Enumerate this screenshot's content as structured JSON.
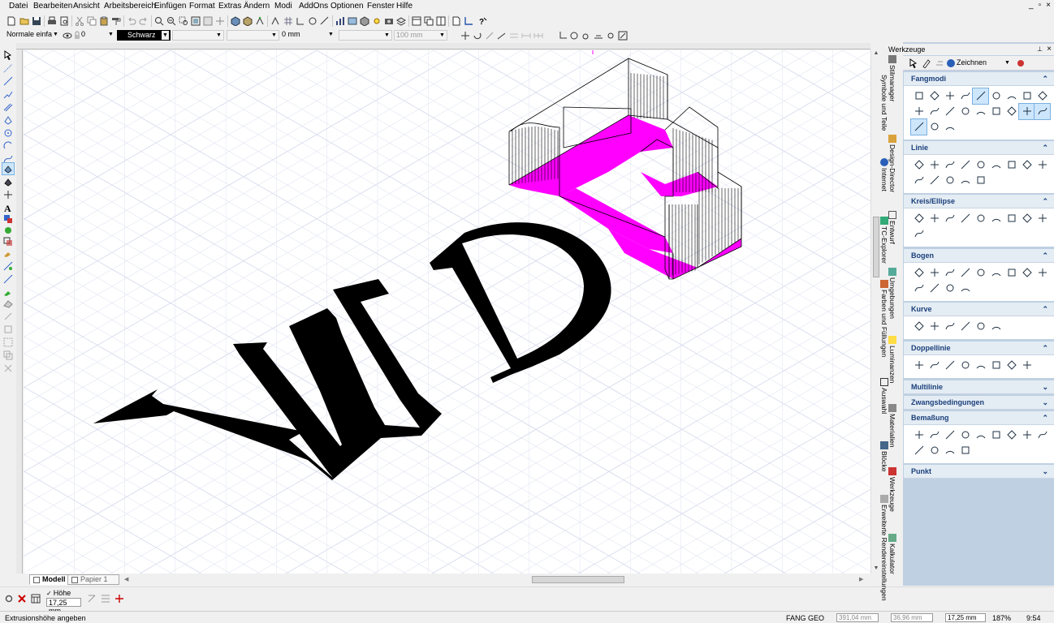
{
  "menu": [
    {
      "label": "Datei"
    },
    {
      "label": "Bearbeiten"
    },
    {
      "label": "Ansicht"
    },
    {
      "label": "Arbeitsbereich"
    },
    {
      "label": "Einfügen"
    },
    {
      "label": "Format"
    },
    {
      "label": "Extras"
    },
    {
      "label": "Ändern"
    },
    {
      "label": "Modi"
    },
    {
      "label": "AddOns"
    },
    {
      "label": "Optionen"
    },
    {
      "label": "Fenster"
    },
    {
      "label": "Hilfe"
    }
  ],
  "window_controls": {
    "minimize": "_",
    "restore": "▫",
    "close": "×"
  },
  "format_bar": {
    "style": "Normale einfa",
    "layer_value": "0",
    "color": "Schwarz",
    "line_width": "0 mm",
    "spacing": "100 mm"
  },
  "tabs": [
    {
      "label": "Modell",
      "active": true
    },
    {
      "label": "Papier 1",
      "active": false
    }
  ],
  "input": {
    "height_label": "Höhe",
    "height_value": "17,25 mm"
  },
  "status": {
    "prompt": "Extrusionshöhe angeben",
    "fang": "FANG",
    "geo": "GEO",
    "coord_x": "391,04 mm",
    "coord_y": "36,96 mm",
    "coord_z": "17,25 mm",
    "zoom": "187%",
    "time": "9:54"
  },
  "side_tabs": [
    "Stilmanager",
    "Symbole und Teile",
    "Design-Director",
    "Internet",
    "Entwurf",
    "TC-Explorer",
    "Umgebungen",
    "Farben und Füllungen",
    "Luminanzen",
    "Auswahl",
    "Materialien",
    "Blöcke",
    "Werkzeuge",
    "Erweiterte Rendereinstellungen",
    "Kalkulator"
  ],
  "panel": {
    "title": "Werkzeuge",
    "mode": "Zeichnen",
    "sections": [
      {
        "label": "Fangmodi",
        "expanded": true
      },
      {
        "label": "Linie",
        "expanded": true
      },
      {
        "label": "Kreis/Ellipse",
        "expanded": true
      },
      {
        "label": "Bogen",
        "expanded": true
      },
      {
        "label": "Kurve",
        "expanded": true
      },
      {
        "label": "Doppellinie",
        "expanded": true
      },
      {
        "label": "Multilinie",
        "expanded": false
      },
      {
        "label": "Zwangsbedingungen",
        "expanded": false
      },
      {
        "label": "Bemaßung",
        "expanded": true
      },
      {
        "label": "Punkt",
        "expanded": false
      }
    ]
  },
  "drawing": {
    "text": "WDE",
    "text_color": "#000000",
    "highlight_color": "#ff00ff",
    "grid_color": "#d8dcee"
  }
}
